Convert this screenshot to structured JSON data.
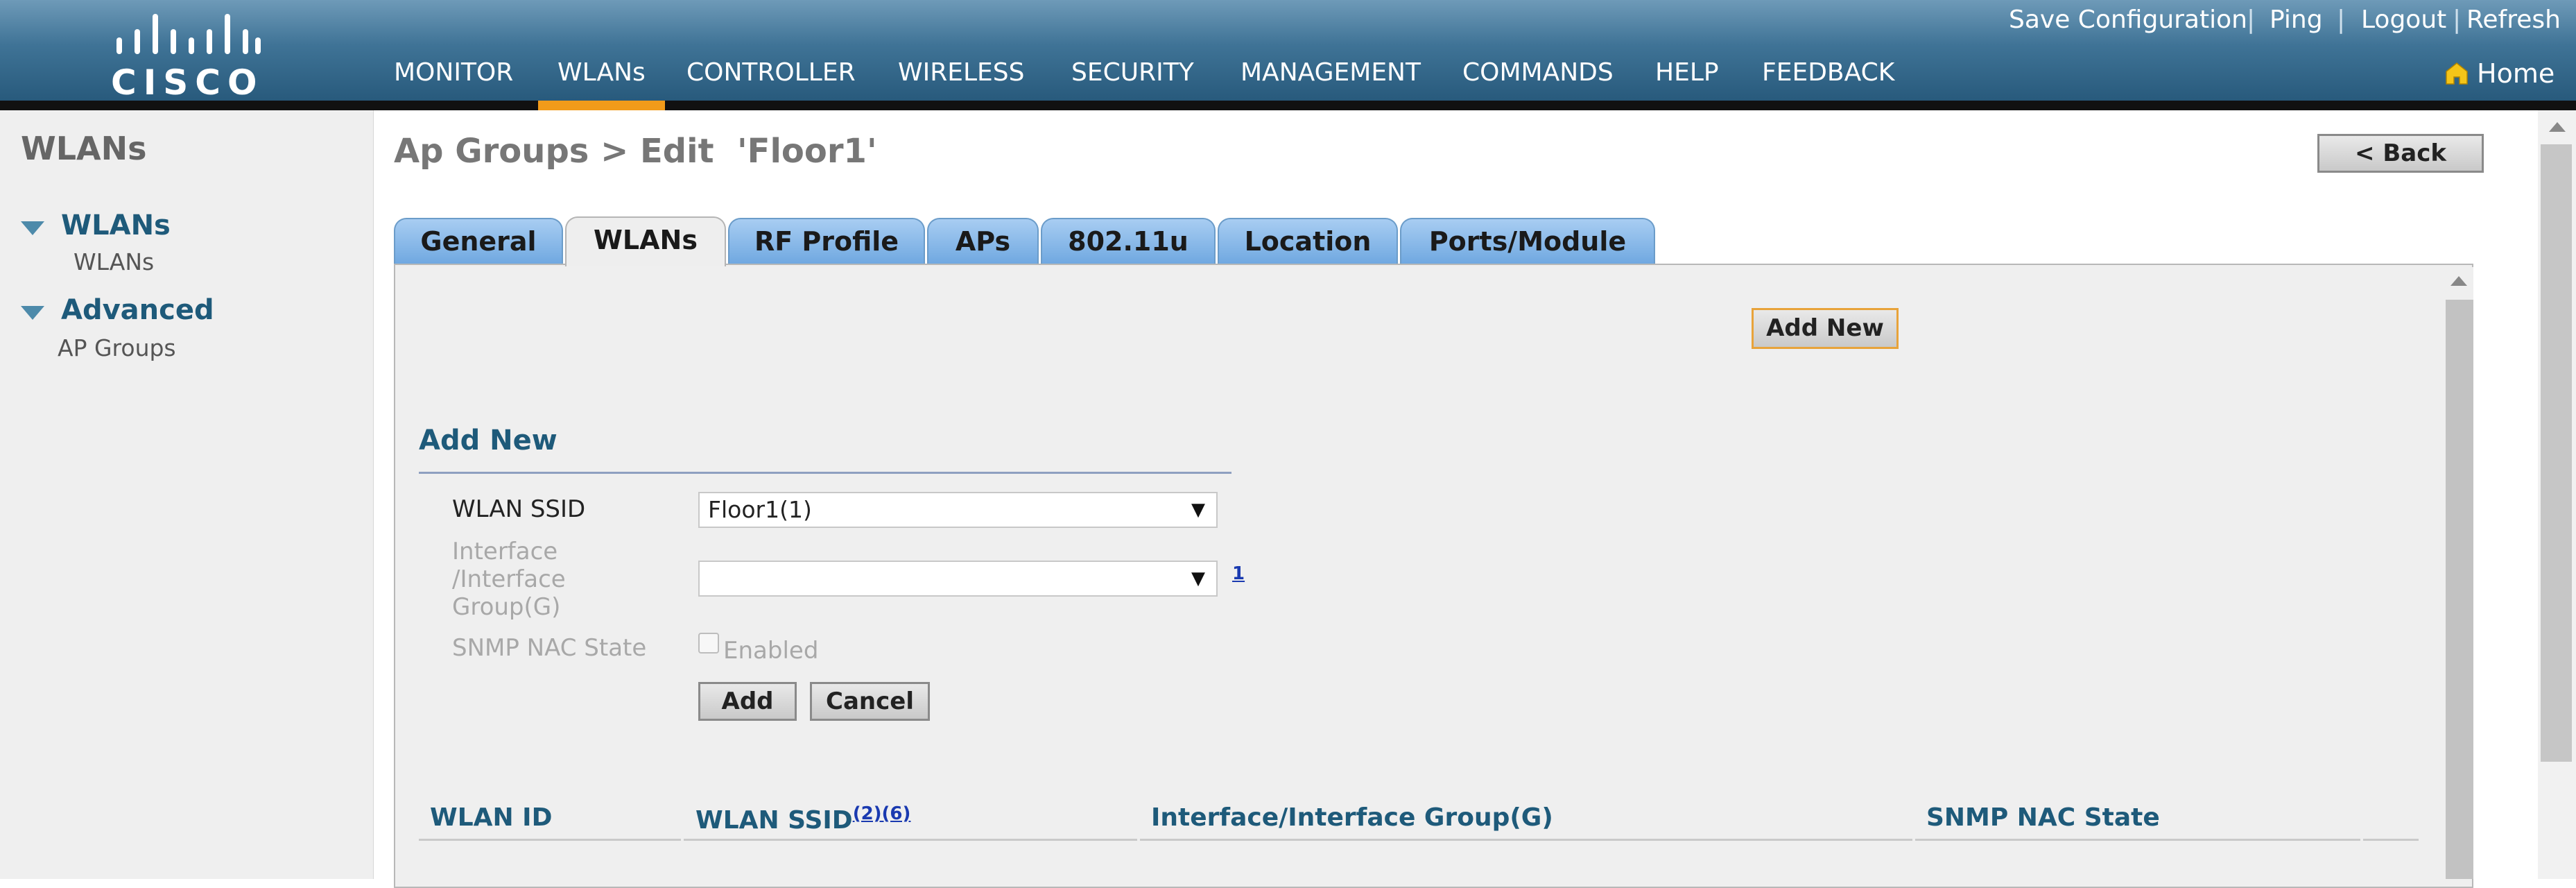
{
  "brand": {
    "logo_text": "CISCO"
  },
  "top_links": {
    "save": "Save Configuration",
    "ping": "Ping",
    "logout": "Logout",
    "refresh": "Refresh",
    "home": "Home",
    "sep": "|"
  },
  "nav": {
    "monitor": "MONITOR",
    "wlans": "WLANs",
    "controller": "CONTROLLER",
    "wireless": "WIRELESS",
    "security": "SECURITY",
    "management": "MANAGEMENT",
    "commands": "COMMANDS",
    "help": "HELP",
    "feedback": "FEEDBACK",
    "active": "WLANs"
  },
  "sidebar": {
    "title": "WLANs",
    "groups": [
      {
        "label": "WLANs",
        "items": [
          "WLANs"
        ]
      },
      {
        "label": "Advanced",
        "items": [
          "AP Groups"
        ]
      }
    ]
  },
  "main": {
    "title": "Ap Groups > Edit  'Floor1'",
    "back_label": "< Back",
    "tabs": [
      "General",
      "WLANs",
      "RF Profile",
      "APs",
      "802.11u",
      "Location",
      "Ports/Module"
    ],
    "active_tab": "WLANs",
    "add_new_button": "Add New",
    "section_title": "Add New",
    "form": {
      "ssid_label": "WLAN SSID",
      "ssid_value": "Floor1(1)",
      "iface_label": "Interface\n/Interface\nGroup(G)",
      "iface_value": "",
      "iface_help": "1",
      "nac_label": "SNMP NAC State",
      "nac_option": "Enabled",
      "nac_checked": false,
      "add_label": "Add",
      "cancel_label": "Cancel"
    },
    "table": {
      "columns": [
        "WLAN ID",
        "WLAN SSID",
        "Interface/Interface Group(G)",
        "SNMP NAC State"
      ],
      "ssid_footnote": "(2)(6)",
      "rows": []
    }
  },
  "colors": {
    "accent": "#f29b1a",
    "header": "#3f7396",
    "link": "#1e5a7a",
    "tab": "#8fbceb"
  }
}
